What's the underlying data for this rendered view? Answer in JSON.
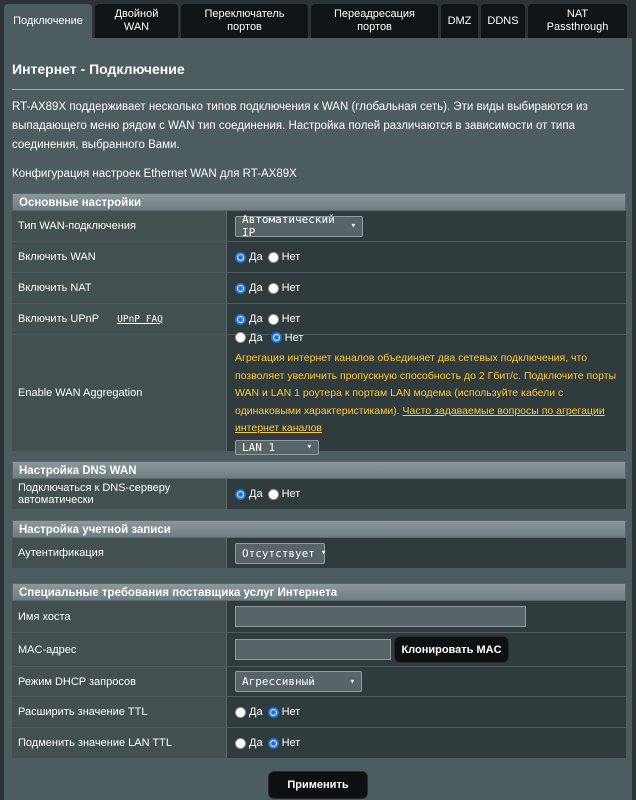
{
  "tabs": [
    {
      "label": "Подключение",
      "active": true
    },
    {
      "label": "Двойной\nWAN"
    },
    {
      "label": "Переключатель\nпортов"
    },
    {
      "label": "Переадресация\nпортов"
    },
    {
      "label": "DMZ"
    },
    {
      "label": "DDNS"
    },
    {
      "label": "NAT\nPassthrough"
    }
  ],
  "page": {
    "title": "Интернет - Подключение",
    "description": "RT-AX89X поддерживает несколько типов подключения к WAN (глобальная сеть). Эти виды выбираются из выпадающего меню рядом с WAN тип соединения. Настройка полей различаются в зависимости от типа соединения, выбранного Вами.",
    "subtitle": "Конфигурация настроек Ethernet WAN для RT-AX89X"
  },
  "basic": {
    "header": "Основные настройки",
    "wan_type_label": "Тип WAN-подключения",
    "wan_type_value": "Автоматический IP",
    "enable_wan_label": "Включить WAN",
    "enable_nat_label": "Включить NAT",
    "enable_upnp_label": "Включить UPnP",
    "upnp_faq": "UPnP  FAQ",
    "aggregation_label": "Enable WAN Aggregation",
    "aggregation_text": "Агрегация интернет каналов объединяет два сетевых подключения, что позволяет увеличить пропускную способность до 2 Гбит/с. Подключите порты WAN и LAN 1 роутера к портам LAN модема (используйте кабели с одинаковыми характеристиками).",
    "aggregation_link": "Часто задаваемые вопросы по агрегации интернет каналов",
    "aggregation_port": "LAN 1"
  },
  "radio": {
    "yes": "Да",
    "no": "Нет"
  },
  "dns": {
    "header": "Настройка DNS WAN",
    "auto_label": "Подключаться к DNS-серверу автоматически"
  },
  "account": {
    "header": "Настройка учетной записи",
    "auth_label": "Аутентификация",
    "auth_value": "Отсутствует"
  },
  "isp": {
    "header": "Специальные требования поставщика услуг Интернета",
    "hostname_label": "Имя хоста",
    "hostname_value": "",
    "mac_label": "MAC-адрес",
    "mac_value": "",
    "clone_mac": "Клонировать MAC",
    "dhcp_label": "Режим DHCP запросов",
    "dhcp_value": "Агрессивный",
    "ttl_label": "Расширить значение TTL",
    "lan_ttl_label": "Подменить значение LAN TTL"
  },
  "apply": "Применить"
}
